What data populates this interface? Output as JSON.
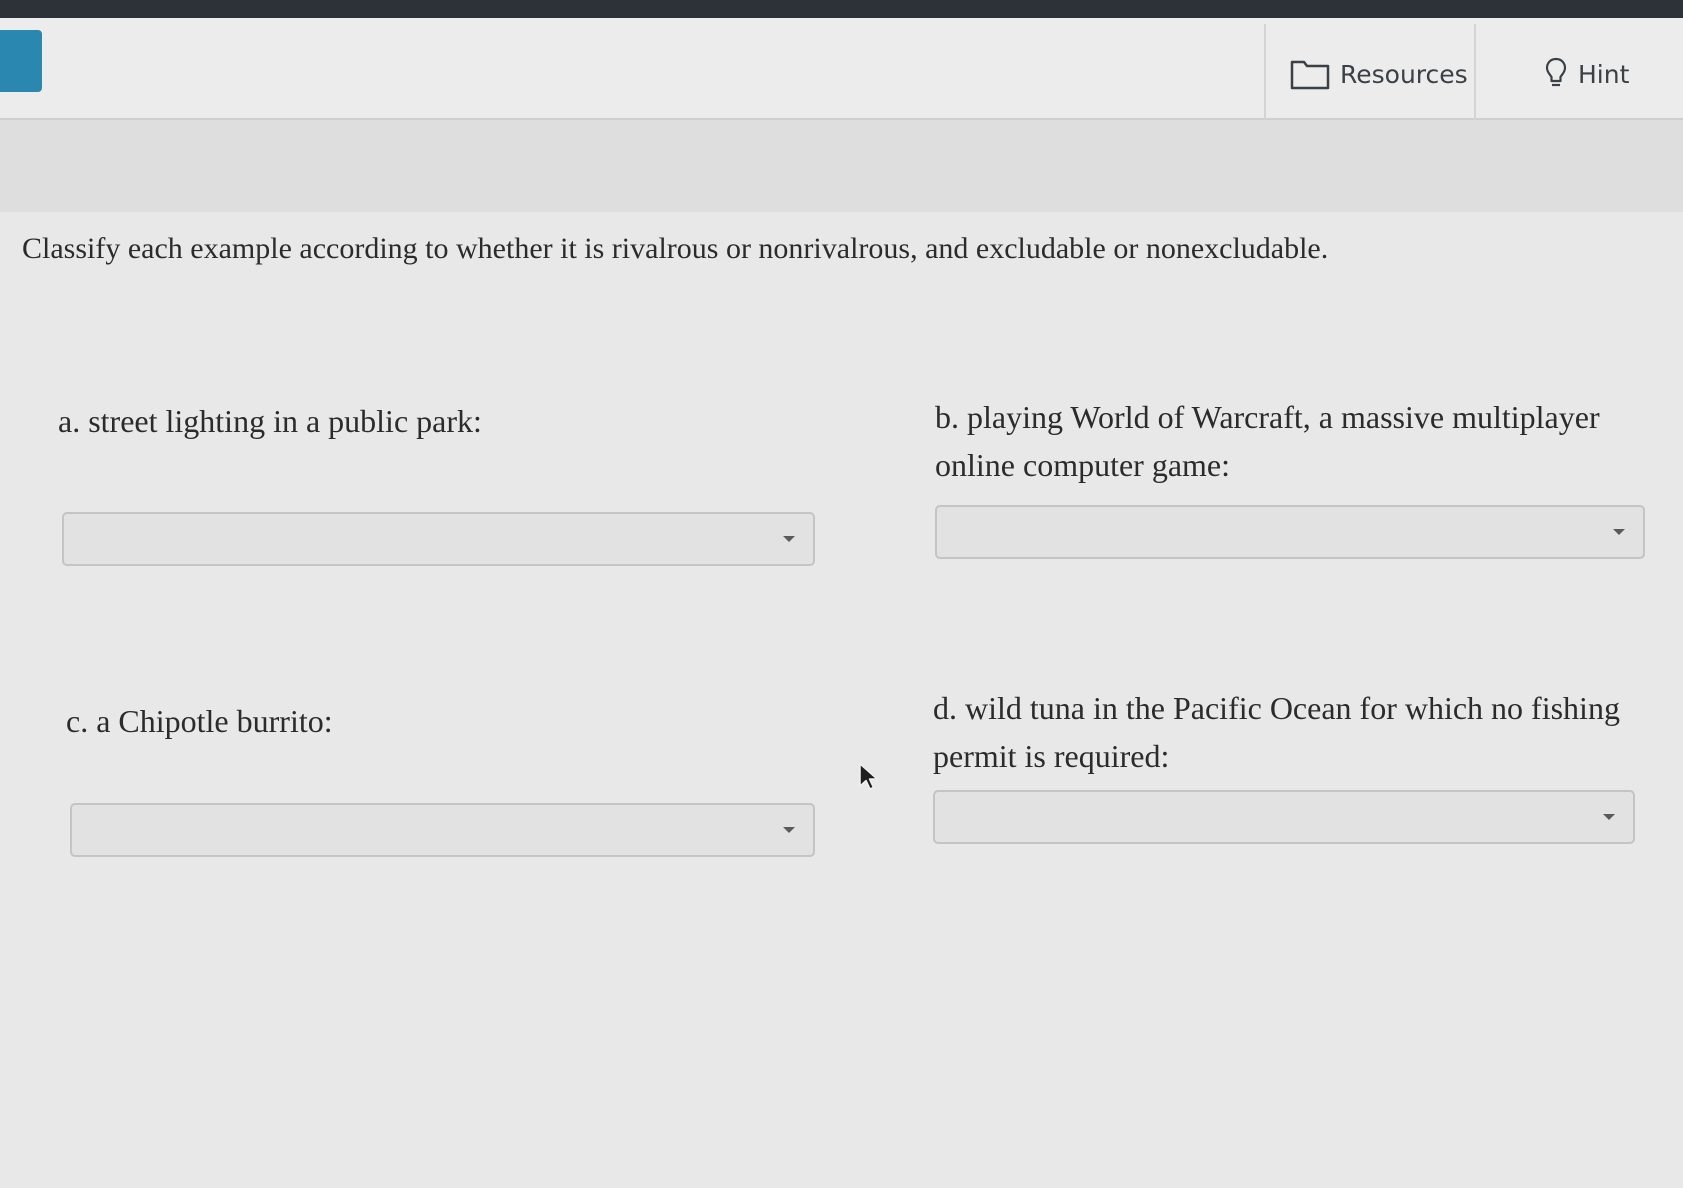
{
  "toolbar": {
    "resources_label": "Resources",
    "hint_label": "Hint"
  },
  "question": {
    "text": "Classify each example according to whether it is rivalrous or nonrivalrous, and excludable or nonexcludable."
  },
  "items": [
    {
      "letter": "a",
      "text": ". street lighting in a public park:",
      "selected": ""
    },
    {
      "letter": "b",
      "text": ". playing World of Warcraft, a massive multiplayer online computer game:",
      "selected": ""
    },
    {
      "letter": "c",
      "text": ". a Chipotle burrito:",
      "selected": ""
    },
    {
      "letter": "d",
      "text": ". wild tuna in the Pacific Ocean for which no fishing permit is required:",
      "selected": ""
    }
  ],
  "icons": {
    "resources": "folder-icon",
    "hint": "lightbulb-icon",
    "dropdown": "caret-down-icon",
    "cursor": "mouse-pointer-icon"
  },
  "colors": {
    "menu_button": "#2a87b0",
    "topbar": "#2c3238",
    "background": "#e8e8e8"
  }
}
